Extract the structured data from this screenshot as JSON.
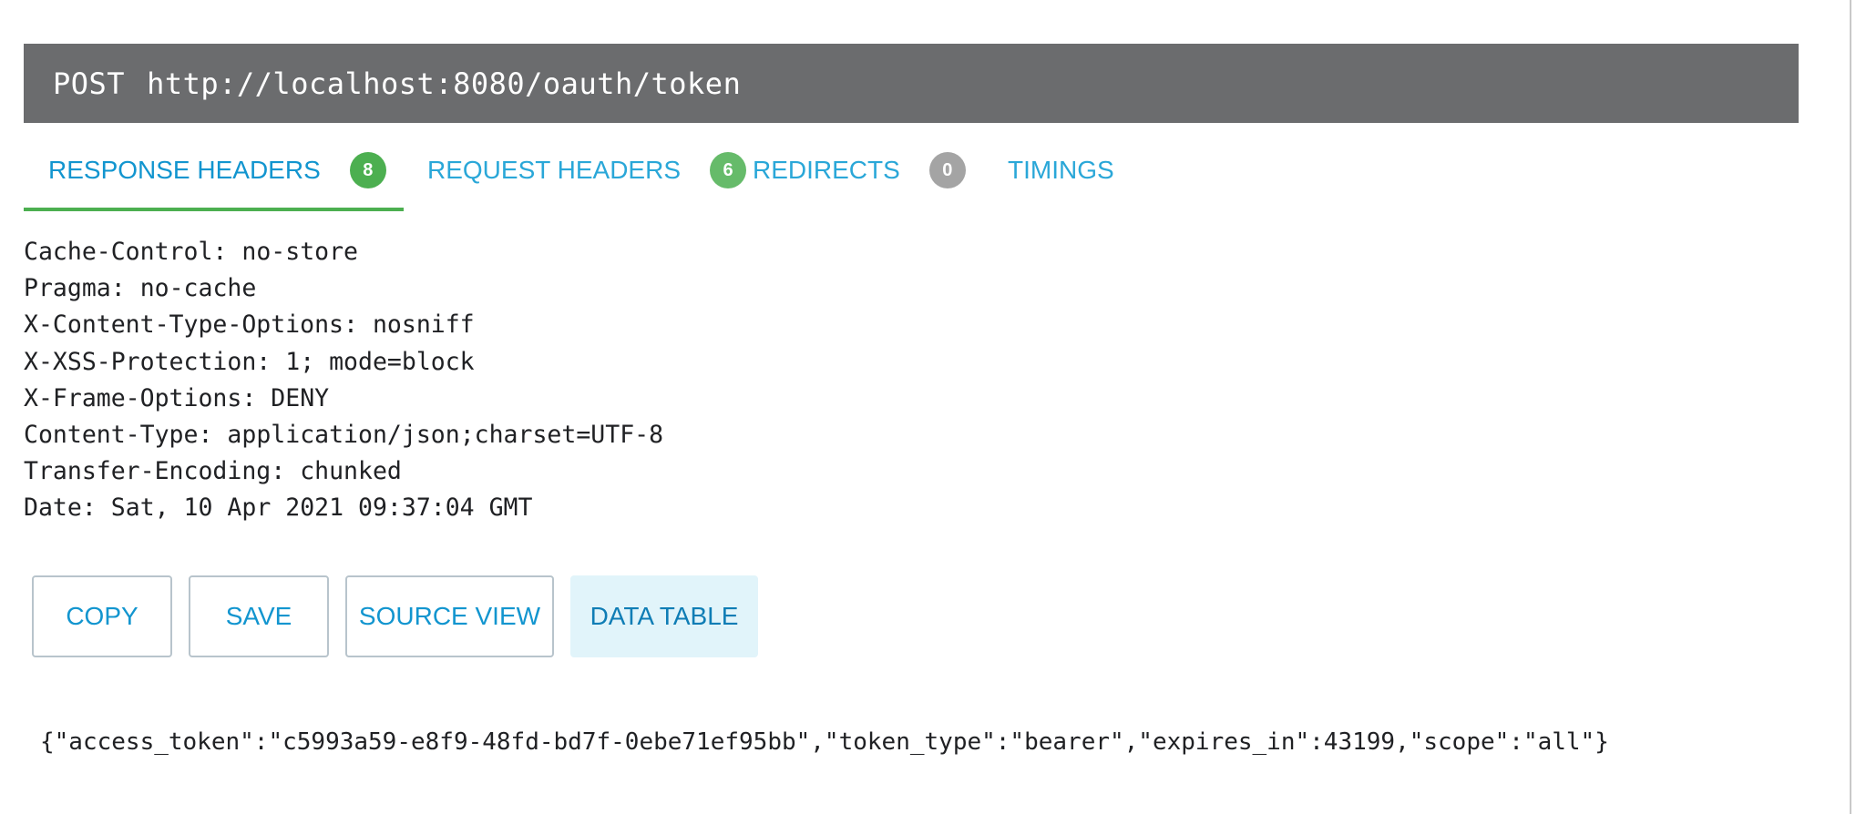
{
  "request": {
    "method": "POST",
    "url": "http://localhost:8080/oauth/token"
  },
  "tabs": [
    {
      "label": "RESPONSE HEADERS",
      "count": "8",
      "active": true
    },
    {
      "label": "REQUEST HEADERS",
      "count": "6",
      "active": false
    },
    {
      "label": "REDIRECTS",
      "count": "0",
      "active": false
    },
    {
      "label": "TIMINGS",
      "active": false
    }
  ],
  "headers": [
    {
      "name": "Cache-Control:",
      "value": "no-store"
    },
    {
      "name": "Pragma:",
      "value": "no-cache"
    },
    {
      "name": "X-Content-Type-Options:",
      "value": "nosniff"
    },
    {
      "name": "X-XSS-Protection:",
      "value": "1; mode=block"
    },
    {
      "name": "X-Frame-Options:",
      "value": "DENY"
    },
    {
      "name": "Content-Type:",
      "value": "application/json;charset=UTF-8"
    },
    {
      "name": "Transfer-Encoding:",
      "value": "chunked"
    },
    {
      "name": "Date:",
      "value": "Sat, 10 Apr 2021 09:37:04 GMT"
    }
  ],
  "actions": {
    "copy": "COPY",
    "save": "SAVE",
    "source_view": "SOURCE VIEW",
    "data_table": "DATA TABLE"
  },
  "body": "{\"access_token\":\"c5993a59-e8f9-48fd-bd7f-0ebe71ef95bb\",\"token_type\":\"bearer\",\"expires_in\":43199,\"scope\":\"all\"}",
  "colors": {
    "accent": "#1295cf",
    "active_tab_underline": "#4caf50",
    "request_bar": "#6b6c6e",
    "badge_green": "#4caf50",
    "badge_gray": "#a4a4a4"
  }
}
